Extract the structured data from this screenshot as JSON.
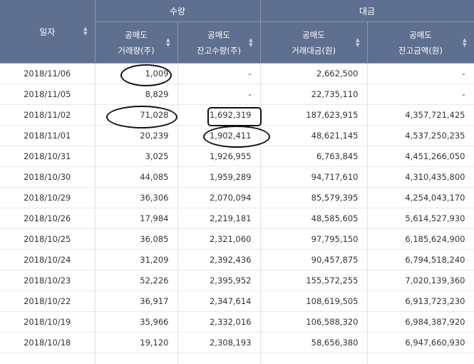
{
  "header": {
    "date_label": "일자",
    "group_volume": "수량",
    "group_amount": "대금",
    "cols": [
      {
        "l1": "공매도",
        "l2": "거래량(주)"
      },
      {
        "l1": "공매도",
        "l2": "잔고수량(주)"
      },
      {
        "l1": "공매도",
        "l2": "거래대금(원)"
      },
      {
        "l1": "공매도",
        "l2": "잔고금액(원)"
      }
    ]
  },
  "icons": {
    "sort": "sort-arrows-icon"
  },
  "rows": [
    {
      "date": "2018/11/06",
      "vol": "1,009",
      "bal": "-",
      "amt": "2,662,500",
      "bam": "-"
    },
    {
      "date": "2018/11/05",
      "vol": "8,829",
      "bal": "-",
      "amt": "22,735,110",
      "bam": "-"
    },
    {
      "date": "2018/11/02",
      "vol": "71,028",
      "bal": "1,692,319",
      "amt": "187,623,915",
      "bam": "4,357,721,425"
    },
    {
      "date": "2018/11/01",
      "vol": "20,239",
      "bal": "1,902,411",
      "amt": "48,621,145",
      "bam": "4,537,250,235"
    },
    {
      "date": "2018/10/31",
      "vol": "3,025",
      "bal": "1,926,955",
      "amt": "6,763,845",
      "bam": "4,451,266,050"
    },
    {
      "date": "2018/10/30",
      "vol": "44,085",
      "bal": "1,959,289",
      "amt": "94,717,610",
      "bam": "4,310,435,800"
    },
    {
      "date": "2018/10/29",
      "vol": "36,306",
      "bal": "2,070,094",
      "amt": "85,579,395",
      "bam": "4,254,043,170"
    },
    {
      "date": "2018/10/26",
      "vol": "17,984",
      "bal": "2,219,181",
      "amt": "48,585,605",
      "bam": "5,614,527,930"
    },
    {
      "date": "2018/10/25",
      "vol": "36,085",
      "bal": "2,321,060",
      "amt": "97,795,150",
      "bam": "6,185,624,900"
    },
    {
      "date": "2018/10/24",
      "vol": "31,209",
      "bal": "2,392,436",
      "amt": "90,457,875",
      "bam": "6,794,518,240"
    },
    {
      "date": "2018/10/23",
      "vol": "52,226",
      "bal": "2,395,952",
      "amt": "155,572,255",
      "bam": "7,020,139,360"
    },
    {
      "date": "2018/10/22",
      "vol": "36,917",
      "bal": "2,347,614",
      "amt": "108,619,505",
      "bam": "6,913,723,230"
    },
    {
      "date": "2018/10/19",
      "vol": "35,966",
      "bal": "2,332,016",
      "amt": "106,588,320",
      "bam": "6,984,387,920"
    },
    {
      "date": "2018/10/18",
      "vol": "19,120",
      "bal": "2,308,193",
      "amt": "58,656,380",
      "bam": "6,947,660,930"
    },
    {
      "date": "",
      "vol": "",
      "bal": "",
      "amt": "",
      "bam": ""
    }
  ]
}
